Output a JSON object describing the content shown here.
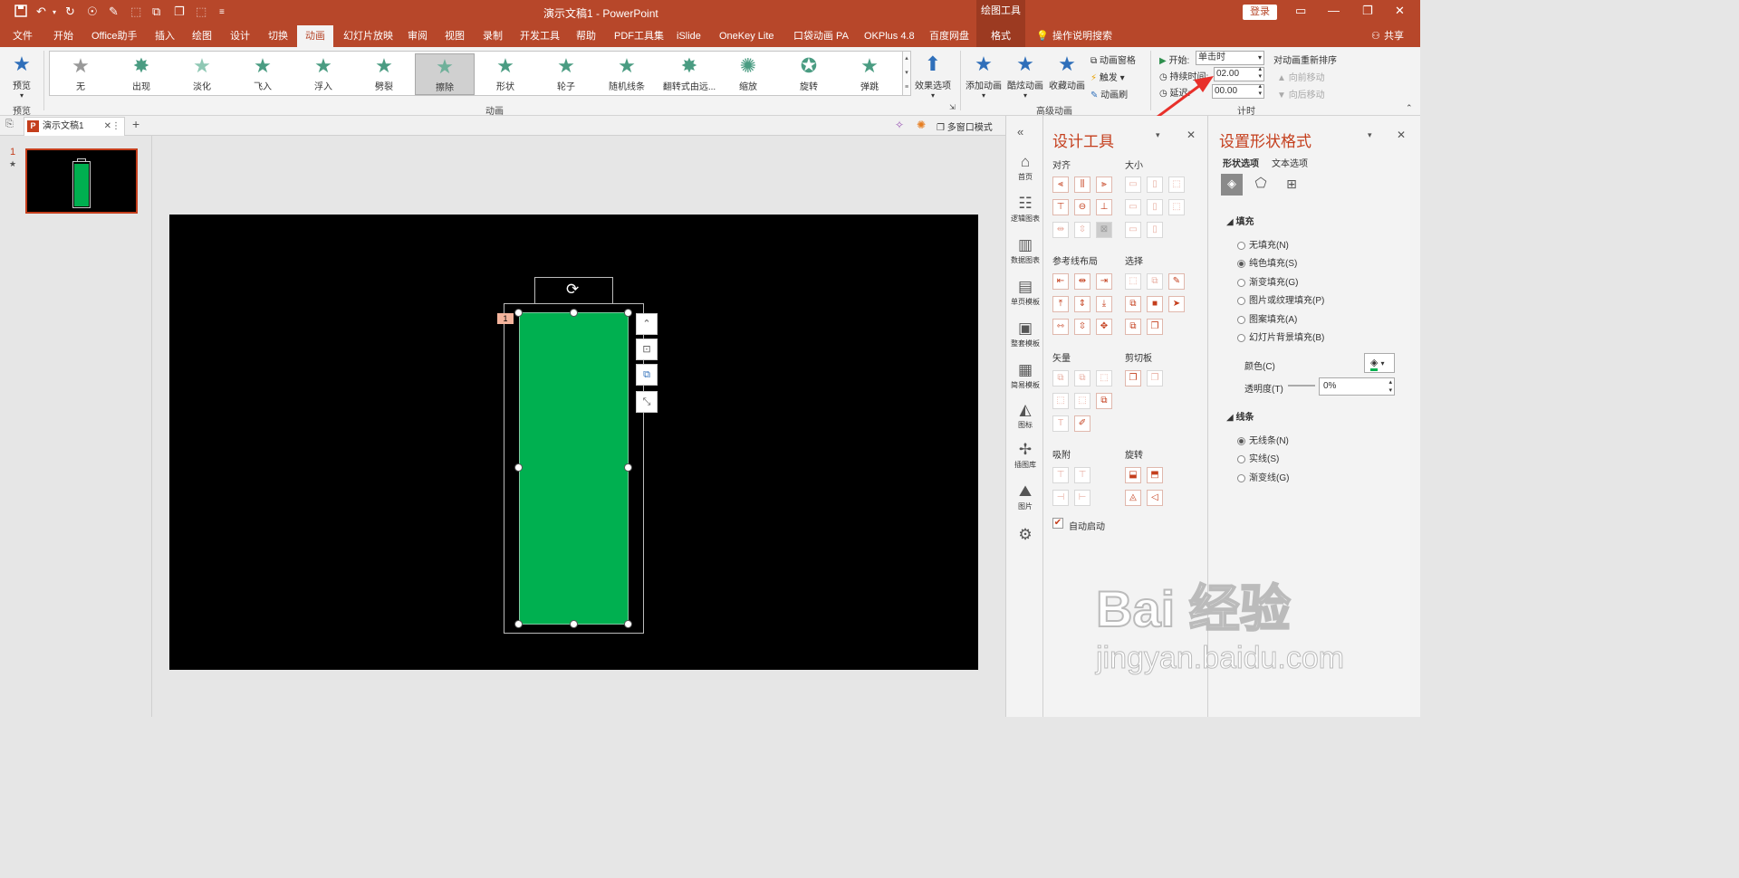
{
  "titlebar": {
    "title": "演示文稿1  -  PowerPoint",
    "drawing_tools": "绘图工具",
    "login": "登录",
    "qa_icons": [
      "save-icon",
      "undo-icon",
      "redo-icon",
      "refresh-icon",
      "brush-icon",
      "select-icon",
      "group-icon",
      "align-icon",
      "more-icon"
    ]
  },
  "tabs": [
    {
      "label": "文件"
    },
    {
      "label": "开始"
    },
    {
      "label": "Office助手"
    },
    {
      "label": "插入"
    },
    {
      "label": "绘图"
    },
    {
      "label": "设计"
    },
    {
      "label": "切换"
    },
    {
      "label": "动画"
    },
    {
      "label": "幻灯片放映"
    },
    {
      "label": "审阅"
    },
    {
      "label": "视图"
    },
    {
      "label": "录制"
    },
    {
      "label": "开发工具"
    },
    {
      "label": "帮助"
    },
    {
      "label": "PDF工具集"
    },
    {
      "label": "iSlide"
    },
    {
      "label": "OneKey Lite"
    },
    {
      "label": "口袋动画 PA"
    },
    {
      "label": "OKPlus 4.8"
    },
    {
      "label": "百度网盘"
    },
    {
      "label": "格式"
    }
  ],
  "tell_me": "操作说明搜索",
  "share": "共享",
  "ribbon": {
    "preview": {
      "label": "预览",
      "group": "预览"
    },
    "animations": {
      "group": "动画",
      "items": [
        "无",
        "出现",
        "淡化",
        "飞入",
        "浮入",
        "劈裂",
        "擦除",
        "形状",
        "轮子",
        "随机线条",
        "翻转式由远...",
        "缩放",
        "旋转",
        "弹跳"
      ],
      "selected": "擦除"
    },
    "effect_options": "效果选项",
    "advanced": {
      "group": "高级动画",
      "add": "添加动画",
      "brush_anim": "酷炫动画",
      "fav": "收藏动画",
      "pane": "动画窗格",
      "trigger": "触发",
      "painter": "动画刷"
    },
    "timing": {
      "group": "计时",
      "start_label": "开始:",
      "start_value": "单击时",
      "duration_label": "持续时间:",
      "duration_value": "02.00",
      "delay_label": "延迟:",
      "delay_value": "00.00",
      "reorder": "对动画重新排序",
      "move_earlier": "向前移动",
      "move_later": "向后移动"
    }
  },
  "doc": {
    "tab_name": "演示文稿1",
    "multiwindow": "多窗口模式",
    "slide_number": "1",
    "slide_star": "★",
    "anim_badge": "1"
  },
  "sidestrip": [
    "首页",
    "逻辑图表",
    "数据图表",
    "单页模板",
    "整套模板",
    "简易模板",
    "图标",
    "插图库",
    "图片"
  ],
  "design_pane": {
    "title": "设计工具",
    "sections": {
      "align": "对齐",
      "size": "大小",
      "guides": "参考线布局",
      "select": "选择",
      "vector": "矢量",
      "clipboard": "剪切板",
      "snap": "吸附",
      "rotate": "旋转"
    },
    "autostart": "自动启动"
  },
  "format_pane": {
    "title": "设置形状格式",
    "tab_shape": "形状选项",
    "tab_text": "文本选项",
    "fill_header": "填充",
    "fill_options": [
      "无填充(N)",
      "纯色填充(S)",
      "渐变填充(G)",
      "图片或纹理填充(P)",
      "图案填充(A)",
      "幻灯片背景填充(B)"
    ],
    "fill_selected": "纯色填充(S)",
    "color_label": "颜色(C)",
    "transparency_label": "透明度(T)",
    "transparency_value": "0%",
    "line_header": "线条",
    "line_options": [
      "无线条(N)",
      "实线(S)",
      "渐变线(G)"
    ],
    "line_selected": "无线条(N)"
  },
  "colors": {
    "accent": "#b7472a",
    "fill_green": "#00b050",
    "slide_bg": "#000000"
  },
  "watermark": {
    "brand": "Bai  经验",
    "url": "jingyan.baidu.com"
  }
}
